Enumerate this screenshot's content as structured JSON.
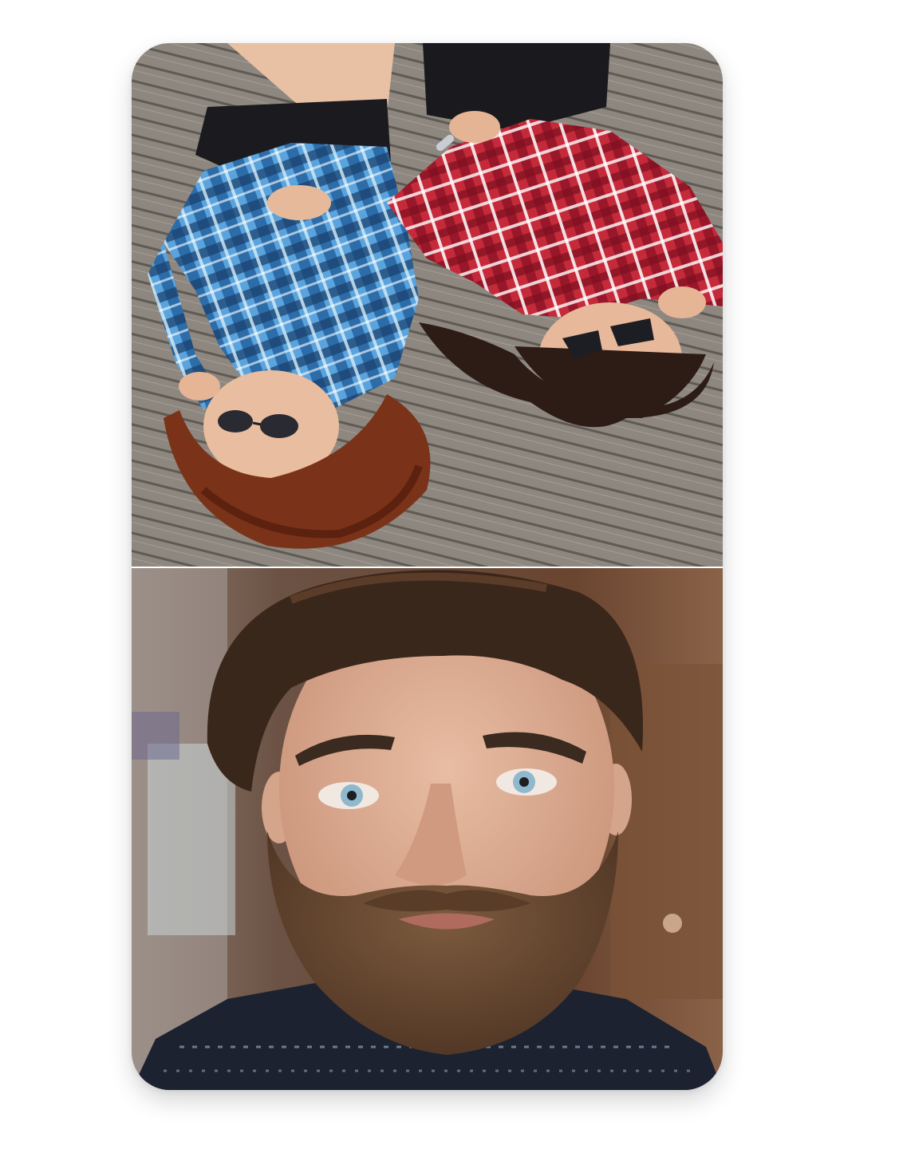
{
  "photos": [
    {
      "slot": "top",
      "icon": "photo-icon",
      "scene": "two-friends-lying-on-deck",
      "colors": {
        "deck": "#8b857d",
        "deck_line": "#5e5953",
        "left_shirt": "#3f86c9",
        "right_shirt": "#c4283a",
        "hair_left": "#7a3319",
        "hair_right": "#2d1c16",
        "skin": "#e7b89a"
      }
    },
    {
      "slot": "bottom",
      "icon": "photo-icon",
      "scene": "bearded-man-portrait",
      "colors": {
        "background": "#6d4c36",
        "skin": "#dcae94",
        "hair": "#3a271b",
        "beard": "#6a4a33",
        "eyes": "#8fb8cc",
        "sweater": "#1c2230"
      }
    }
  ]
}
